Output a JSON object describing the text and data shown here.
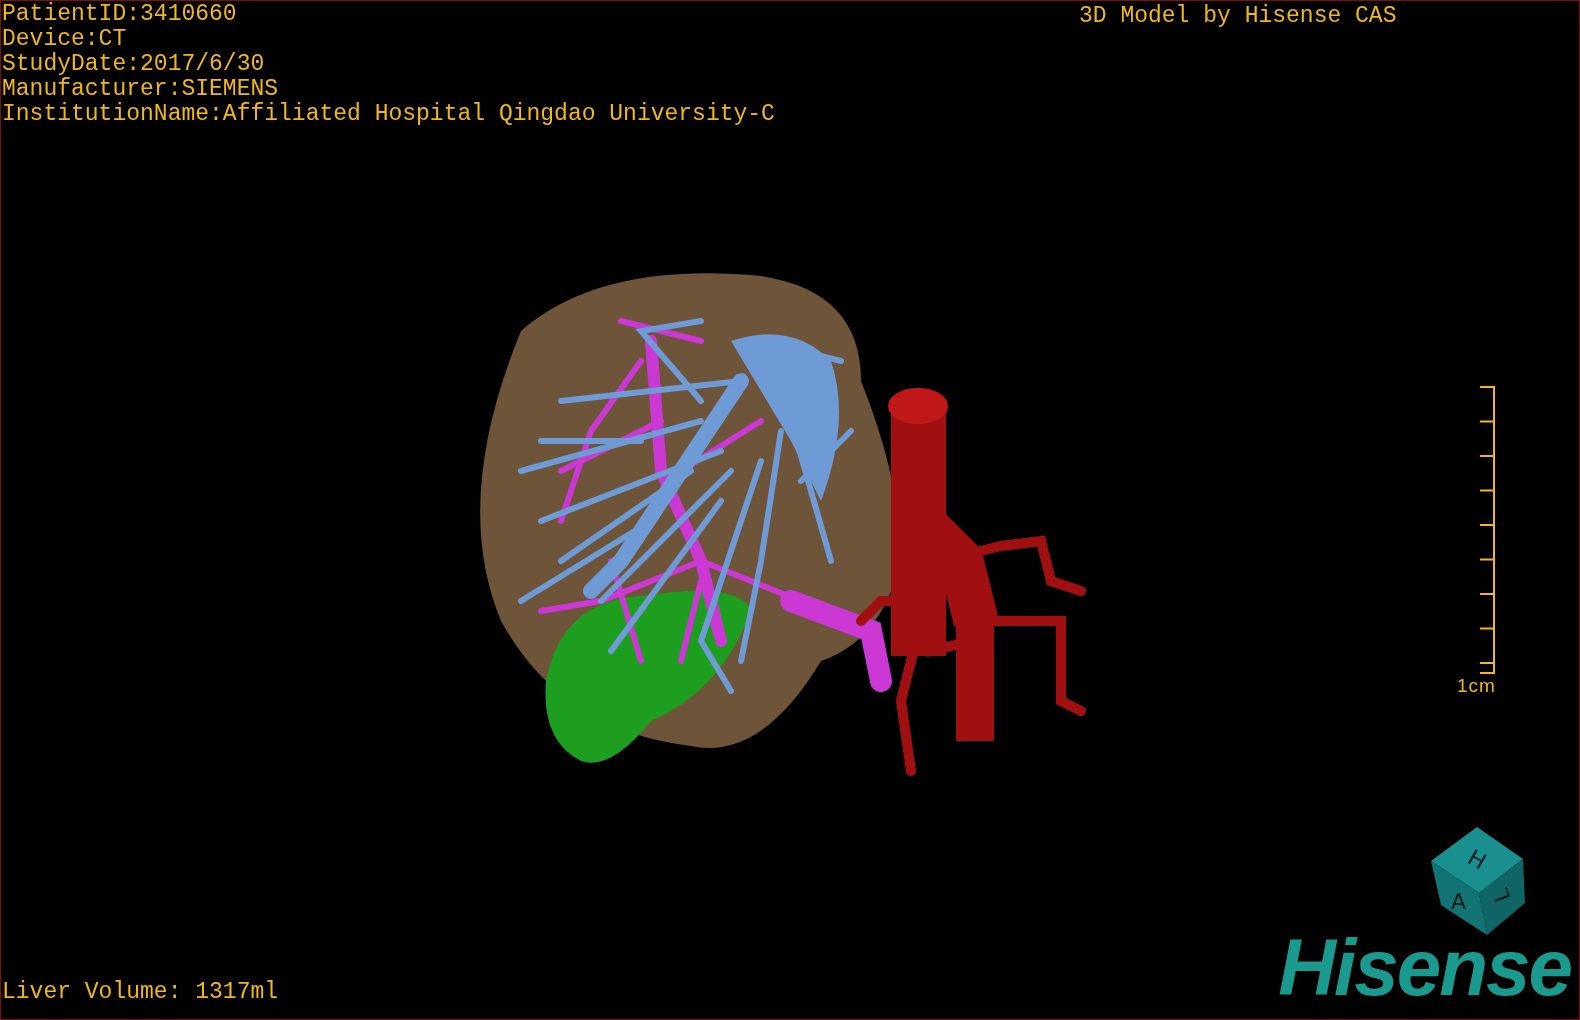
{
  "info_lines": [
    "PatientID:3410660",
    "Device:CT",
    "StudyDate:2017/6/30",
    "Manufacturer:SIEMENS",
    "InstitutionName:Affiliated Hospital Qingdao University-C"
  ],
  "model_caption": "3D Model by Hisense CAS",
  "scale_bar": {
    "label": "1cm"
  },
  "orientation_cube": {
    "top": "H",
    "front": "A",
    "side": "L"
  },
  "logo": "Hisense",
  "volume": "Liver Volume: 1317ml"
}
